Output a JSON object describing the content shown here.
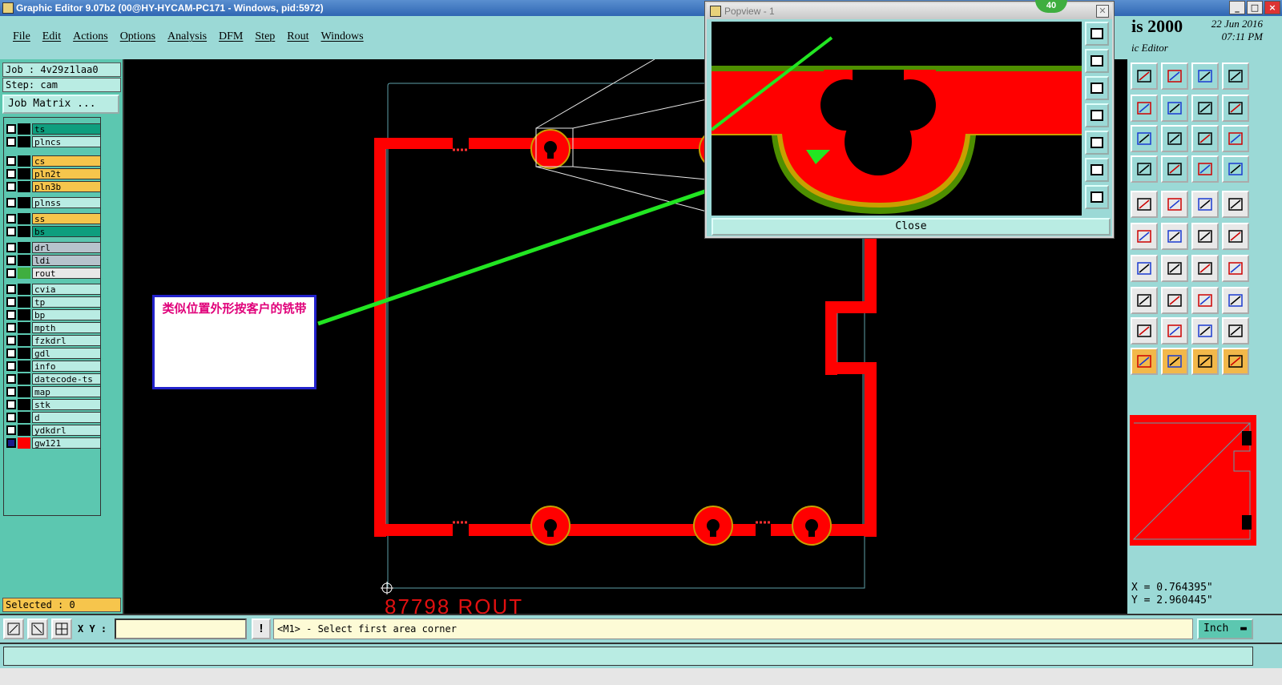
{
  "window": {
    "title": "Graphic Editor 9.07b2 (00@HY-HYCAM-PC171 - Windows, pid:5972)",
    "controls": [
      "_",
      "□",
      "×"
    ]
  },
  "menu": [
    "File",
    "Edit",
    "Actions",
    "Options",
    "Analysis",
    "DFM",
    "Step",
    "Rout",
    "Windows"
  ],
  "brand": {
    "name": "is 2000",
    "subtitle": "ic Editor",
    "date": "22 Jun 2016",
    "time": "07:11 PM"
  },
  "job": {
    "job_label": "Job : 4v29z1laa0",
    "step_label": "Step: cam",
    "matrix_button": "Job Matrix ..."
  },
  "layers": [
    {
      "name": "ts",
      "color": "#0e9e7e"
    },
    {
      "name": "plncs",
      "color": "#b9ece3"
    },
    {
      "name": "cs",
      "color": "#f6c54c"
    },
    {
      "name": "pln2t",
      "color": "#f6c54c"
    },
    {
      "name": "pln3b",
      "color": "#f6c54c"
    },
    {
      "name": "plnss",
      "color": "#b9ece3"
    },
    {
      "name": "ss",
      "color": "#f6c54c"
    },
    {
      "name": "bs",
      "color": "#0e9e7e"
    },
    {
      "name": "drl",
      "color": "#b7c3cc"
    },
    {
      "name": "ldi",
      "color": "#b7c3cc"
    },
    {
      "name": "rout",
      "color": "#e8e8e8"
    },
    {
      "name": "cvia",
      "color": "#b9ece3"
    },
    {
      "name": "tp",
      "color": "#b9ece3"
    },
    {
      "name": "bp",
      "color": "#b9ece3"
    },
    {
      "name": "mpth",
      "color": "#b9ece3"
    },
    {
      "name": "fzkdrl",
      "color": "#b9ece3"
    },
    {
      "name": "gdl",
      "color": "#b9ece3"
    },
    {
      "name": "info",
      "color": "#b9ece3"
    },
    {
      "name": "datecode-ts",
      "color": "#b9ece3"
    },
    {
      "name": "map",
      "color": "#b9ece3"
    },
    {
      "name": "stk",
      "color": "#b9ece3"
    },
    {
      "name": "d",
      "color": "#b9ece3"
    },
    {
      "name": "ydkdrl",
      "color": "#b9ece3"
    },
    {
      "name": "gw121",
      "color": "#b9ece3"
    }
  ],
  "selected": "Selected : 0",
  "popview": {
    "title": "Popview - 1",
    "close_label": "Close",
    "badge": "40"
  },
  "annotation": {
    "text": "类似位置外形按客户的铣带"
  },
  "canvas": {
    "rout_label": "87798  ROUT"
  },
  "coords": {
    "x": "X = 0.764395\"",
    "y": "Y = 2.960445\""
  },
  "bottom": {
    "xy_label": "X Y :",
    "xy_value": "",
    "message": "<M1> - Select first area corner",
    "unit": "Inch"
  }
}
